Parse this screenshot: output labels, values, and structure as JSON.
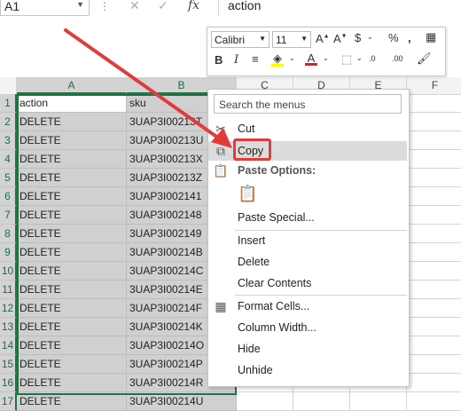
{
  "formula_bar": {
    "name_box": "A1",
    "formula": "action",
    "cancel_icon": "✕",
    "enter_icon": "✓",
    "fx_label": "fx"
  },
  "mini_toolbar": {
    "font_name": "Calibri",
    "font_size": "11"
  },
  "columns": [
    "A",
    "B",
    "C",
    "D",
    "E",
    "F"
  ],
  "rows": [
    {
      "n": "1",
      "a": "action",
      "b": "sku"
    },
    {
      "n": "2",
      "a": "DELETE",
      "b": "3UAP3I00213T"
    },
    {
      "n": "3",
      "a": "DELETE",
      "b": "3UAP3I00213U"
    },
    {
      "n": "4",
      "a": "DELETE",
      "b": "3UAP3I00213X"
    },
    {
      "n": "5",
      "a": "DELETE",
      "b": "3UAP3I00213Z"
    },
    {
      "n": "6",
      "a": "DELETE",
      "b": "3UAP3I002141"
    },
    {
      "n": "7",
      "a": "DELETE",
      "b": "3UAP3I002148"
    },
    {
      "n": "8",
      "a": "DELETE",
      "b": "3UAP3I002149"
    },
    {
      "n": "9",
      "a": "DELETE",
      "b": "3UAP3I00214B"
    },
    {
      "n": "10",
      "a": "DELETE",
      "b": "3UAP3I00214C"
    },
    {
      "n": "11",
      "a": "DELETE",
      "b": "3UAP3I00214E"
    },
    {
      "n": "12",
      "a": "DELETE",
      "b": "3UAP3I00214F"
    },
    {
      "n": "13",
      "a": "DELETE",
      "b": "3UAP3I00214K"
    },
    {
      "n": "14",
      "a": "DELETE",
      "b": "3UAP3I00214O"
    },
    {
      "n": "15",
      "a": "DELETE",
      "b": "3UAP3I00214P"
    },
    {
      "n": "16",
      "a": "DELETE",
      "b": "3UAP3I00214R"
    },
    {
      "n": "17",
      "a": "DELETE",
      "b": "3UAP3I00214U"
    }
  ],
  "context_menu": {
    "search_placeholder": "Search the menus",
    "cut": "Cut",
    "copy": "Copy",
    "paste_options": "Paste Options:",
    "paste_special": "Paste Special...",
    "insert": "Insert",
    "delete": "Delete",
    "clear_contents": "Clear Contents",
    "format_cells": "Format Cells...",
    "column_width": "Column Width...",
    "hide": "Hide",
    "unhide": "Unhide"
  },
  "colors": {
    "excel_green": "#217346",
    "highlight_red": "#e03c3c",
    "selection_gray": "#d0d0d0"
  }
}
